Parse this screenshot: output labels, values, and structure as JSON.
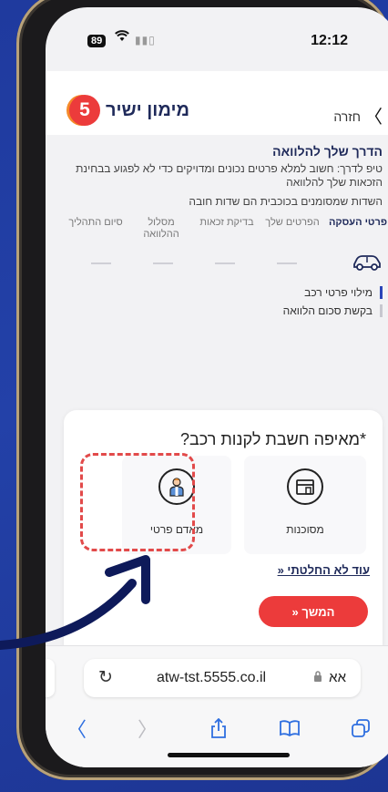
{
  "status_bar": {
    "time": "12:12",
    "battery": "89"
  },
  "header": {
    "back_label": "חזרה",
    "logo_number": "5",
    "logo_text": "מימון ישיר"
  },
  "intro": {
    "title": "הדרך שלך להלוואה",
    "tip": "טיפ לדרך: חשוב למלא פרטים נכונים ומדויקים כדי לא לפגוע בבחינת הזכאות שלך להלוואה",
    "required_note": "השדות שמסומנים בכוכבית הם שדות חובה"
  },
  "steps": [
    {
      "label": "פרטי העסקה",
      "active": true
    },
    {
      "label": "הפרטים שלך",
      "active": false
    },
    {
      "label": "בדיקת זכאות",
      "active": false
    },
    {
      "label": "מסלול ההלוואה",
      "active": false
    },
    {
      "label": "סיום התהליך",
      "active": false
    }
  ],
  "sublinks": [
    {
      "label": "מילוי פרטי רכב",
      "active": true
    },
    {
      "label": "בקשת סכום הלוואה",
      "active": false
    }
  ],
  "card": {
    "question": "*מאיפה חשבת לקנות רכב?",
    "options": [
      {
        "label": "מסוכנות",
        "icon": "storefront-icon"
      },
      {
        "label": "מאדם פרטי",
        "icon": "person-icon"
      }
    ],
    "undecided_link": "עוד לא החלטתי «",
    "continue_button": "המשך «"
  },
  "browser": {
    "url": "atw-tst.5555.co.il",
    "reader_label": "אא"
  },
  "colors": {
    "brand_red": "#ec3b3b",
    "navy": "#1f2a5a",
    "highlight_dash": "#e24a4a",
    "background_blue": "#2341a8"
  }
}
